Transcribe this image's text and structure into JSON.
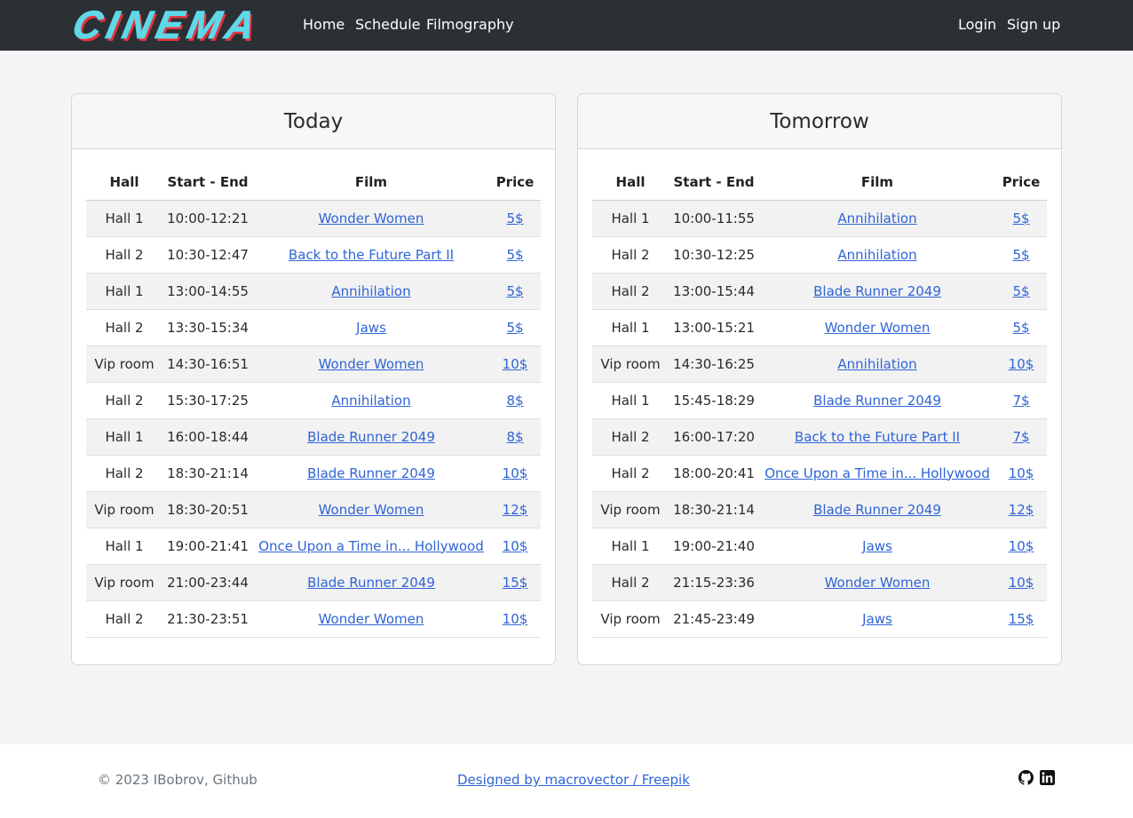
{
  "nav": {
    "brand": "CINEMA",
    "links": [
      {
        "label": "Home"
      },
      {
        "label": "Schedule"
      },
      {
        "label": "Filmography"
      }
    ],
    "auth": {
      "login": "Login",
      "signup": "Sign up"
    }
  },
  "columns": [
    "Hall",
    "Start - End",
    "Film",
    "Price"
  ],
  "schedules": [
    {
      "title": "Today",
      "rows": [
        {
          "hall": "Hall 1",
          "time": "10:00-12:21",
          "film": "Wonder Women",
          "price": "5$"
        },
        {
          "hall": "Hall 2",
          "time": "10:30-12:47",
          "film": "Back to the Future Part II",
          "price": "5$"
        },
        {
          "hall": "Hall 1",
          "time": "13:00-14:55",
          "film": "Annihilation",
          "price": "5$"
        },
        {
          "hall": "Hall 2",
          "time": "13:30-15:34",
          "film": "Jaws",
          "price": "5$"
        },
        {
          "hall": "Vip room",
          "time": "14:30-16:51",
          "film": "Wonder Women",
          "price": "10$"
        },
        {
          "hall": "Hall 2",
          "time": "15:30-17:25",
          "film": "Annihilation",
          "price": "8$"
        },
        {
          "hall": "Hall 1",
          "time": "16:00-18:44",
          "film": "Blade Runner 2049",
          "price": "8$"
        },
        {
          "hall": "Hall 2",
          "time": "18:30-21:14",
          "film": "Blade Runner 2049",
          "price": "10$"
        },
        {
          "hall": "Vip room",
          "time": "18:30-20:51",
          "film": "Wonder Women",
          "price": "12$"
        },
        {
          "hall": "Hall 1",
          "time": "19:00-21:41",
          "film": "Once Upon a Time in... Hollywood",
          "price": "10$"
        },
        {
          "hall": "Vip room",
          "time": "21:00-23:44",
          "film": "Blade Runner 2049",
          "price": "15$"
        },
        {
          "hall": "Hall 2",
          "time": "21:30-23:51",
          "film": "Wonder Women",
          "price": "10$"
        }
      ]
    },
    {
      "title": "Tomorrow",
      "rows": [
        {
          "hall": "Hall 1",
          "time": "10:00-11:55",
          "film": "Annihilation",
          "price": "5$"
        },
        {
          "hall": "Hall 2",
          "time": "10:30-12:25",
          "film": "Annihilation",
          "price": "5$"
        },
        {
          "hall": "Hall 2",
          "time": "13:00-15:44",
          "film": "Blade Runner 2049",
          "price": "5$"
        },
        {
          "hall": "Hall 1",
          "time": "13:00-15:21",
          "film": "Wonder Women",
          "price": "5$"
        },
        {
          "hall": "Vip room",
          "time": "14:30-16:25",
          "film": "Annihilation",
          "price": "10$"
        },
        {
          "hall": "Hall 1",
          "time": "15:45-18:29",
          "film": "Blade Runner 2049",
          "price": "7$"
        },
        {
          "hall": "Hall 2",
          "time": "16:00-17:20",
          "film": "Back to the Future Part II",
          "price": "7$"
        },
        {
          "hall": "Hall 2",
          "time": "18:00-20:41",
          "film": "Once Upon a Time in... Hollywood",
          "price": "10$"
        },
        {
          "hall": "Vip room",
          "time": "18:30-21:14",
          "film": "Blade Runner 2049",
          "price": "12$"
        },
        {
          "hall": "Hall 1",
          "time": "19:00-21:40",
          "film": "Jaws",
          "price": "10$"
        },
        {
          "hall": "Hall 2",
          "time": "21:15-23:36",
          "film": "Wonder Women",
          "price": "10$"
        },
        {
          "hall": "Vip room",
          "time": "21:45-23:49",
          "film": "Jaws",
          "price": "15$"
        }
      ]
    }
  ],
  "footer": {
    "copyright": "© 2023 IBobrov, Github",
    "credit": "Designed by macrovector / Freepik",
    "icons": [
      "github-icon",
      "linkedin-icon"
    ]
  },
  "colors": {
    "navbar": "#2b3035",
    "link": "#2f64d6",
    "logo_fill": "#5fd8e8",
    "logo_shadow": "#e8313c"
  }
}
